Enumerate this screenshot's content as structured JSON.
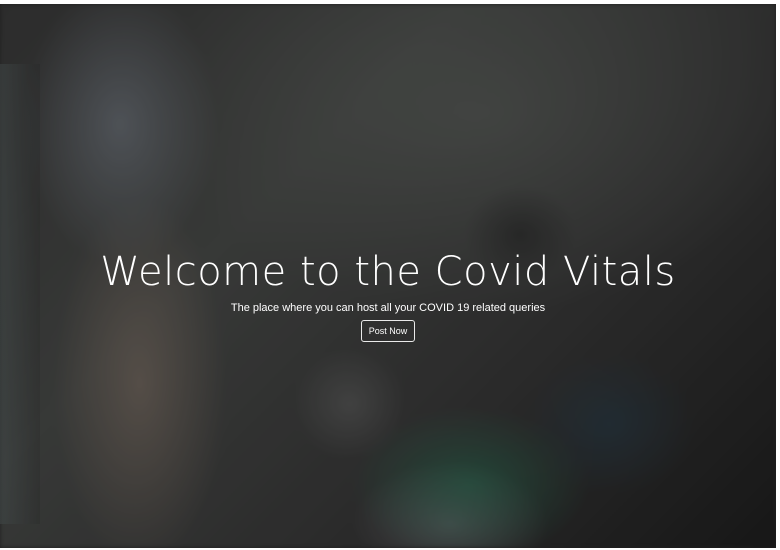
{
  "hero": {
    "title": "Welcome to the Covid Vitals",
    "subtitle": "The place where you can host all your COVID 19 related queries",
    "button_label": "Post Now"
  },
  "colors": {
    "text": "#ffffff",
    "overlay": "#2a2a2a"
  }
}
